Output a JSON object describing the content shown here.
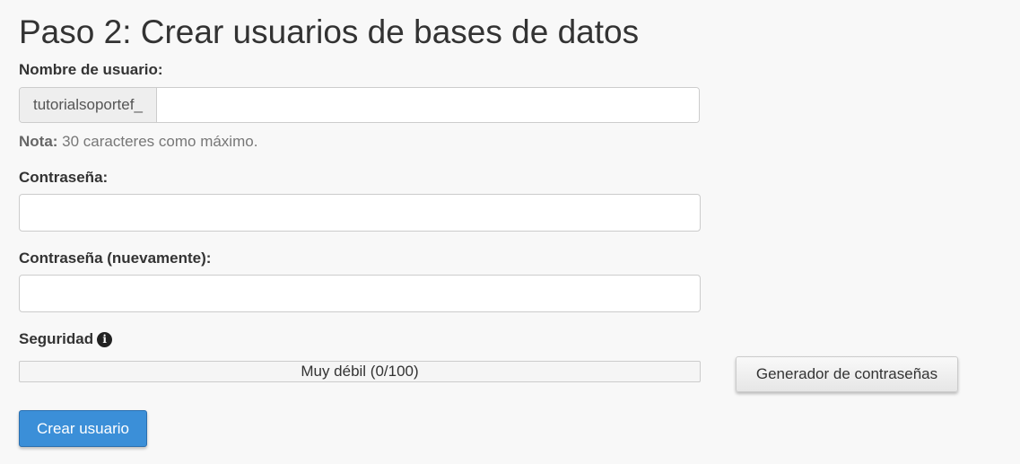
{
  "page": {
    "title": "Paso 2: Crear usuarios de bases de datos"
  },
  "username": {
    "label": "Nombre de usuario:",
    "prefix": "tutorialsoportef_",
    "value": "",
    "note_bold": "Nota:",
    "note_text": " 30 caracteres como máximo."
  },
  "password": {
    "label": "Contraseña:",
    "value": ""
  },
  "password_confirm": {
    "label": "Contraseña (nuevamente):",
    "value": ""
  },
  "security": {
    "label": "Seguridad",
    "info_icon": "info-circle-icon",
    "strength_text": "Muy débil (0/100)",
    "strength_value": 0,
    "generator_button": "Generador de contraseñas"
  },
  "actions": {
    "create_button": "Crear usuario"
  },
  "colors": {
    "primary_button": "#3b8fd8",
    "background": "#f8f8f8"
  }
}
